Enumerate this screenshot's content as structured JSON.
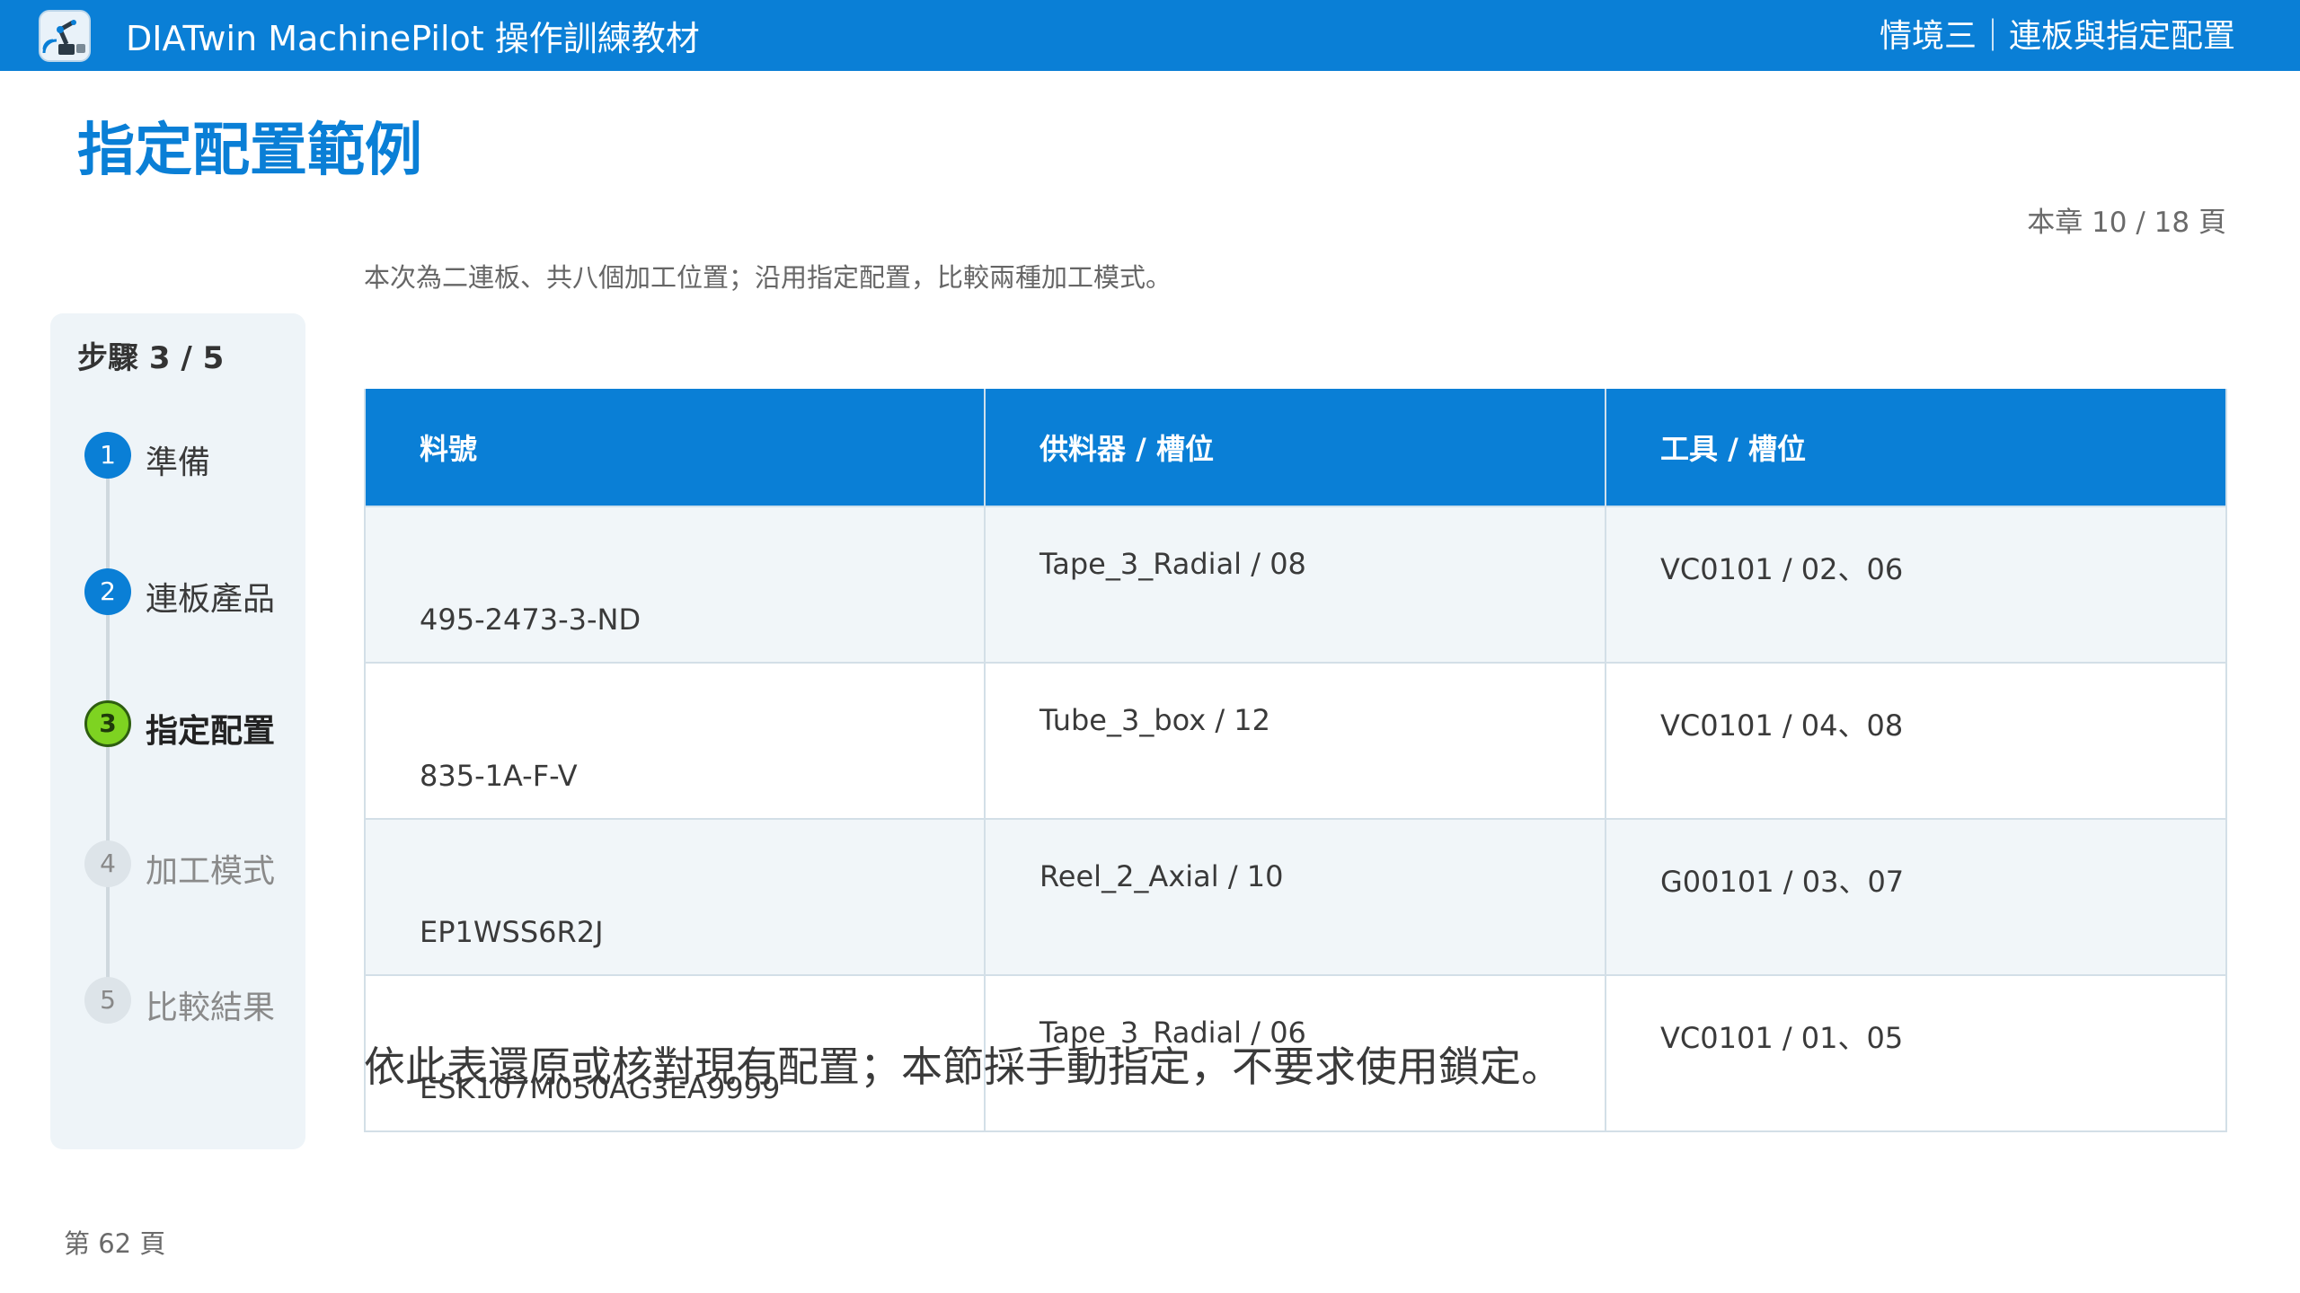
{
  "header": {
    "app_title": "DIATwin MachinePilot 操作訓練教材",
    "chapter_title": "情境三｜連板與指定配置",
    "logo_icon": "robot-arm-app-logo"
  },
  "page": {
    "title": "指定配置範例",
    "chapter_progress": "本章 10 / 18 頁",
    "intro": "本次為二連板、共八個加工位置；沿用指定配置，比較兩種加工模式。",
    "note": "依此表還原或核對現有配置；本節採手動指定，不要求使用鎖定。",
    "page_number": "第 62 頁"
  },
  "stepper": {
    "heading": "步驟 3 / 5",
    "steps": [
      {
        "num": "1",
        "label": "準備",
        "state": "done"
      },
      {
        "num": "2",
        "label": "連板產品",
        "state": "done"
      },
      {
        "num": "3",
        "label": "指定配置",
        "state": "active"
      },
      {
        "num": "4",
        "label": "加工模式",
        "state": "todo"
      },
      {
        "num": "5",
        "label": "比較結果",
        "state": "todo"
      }
    ]
  },
  "table": {
    "headers": [
      "料號",
      "供料器 / 槽位",
      "工具 / 槽位"
    ],
    "rows": [
      {
        "part": "495-2473-3-ND",
        "feeder": "Tape_3_Radial / 08",
        "tool": "VC0101 / 02、06"
      },
      {
        "part": "835-1A-F-V",
        "feeder": "Tube_3_box / 12",
        "tool": "VC0101 / 04、08"
      },
      {
        "part": "EP1WSS6R2J",
        "feeder": "Reel_2_Axial / 10",
        "tool": "G00101 / 03、07"
      },
      {
        "part": "ESK107M050AG3EA9999",
        "feeder": "Tape_3_Radial / 06",
        "tool": "VC0101 / 01、05"
      }
    ]
  },
  "colors": {
    "brand": "#0a7fd6",
    "active_step": "#7ed321"
  }
}
